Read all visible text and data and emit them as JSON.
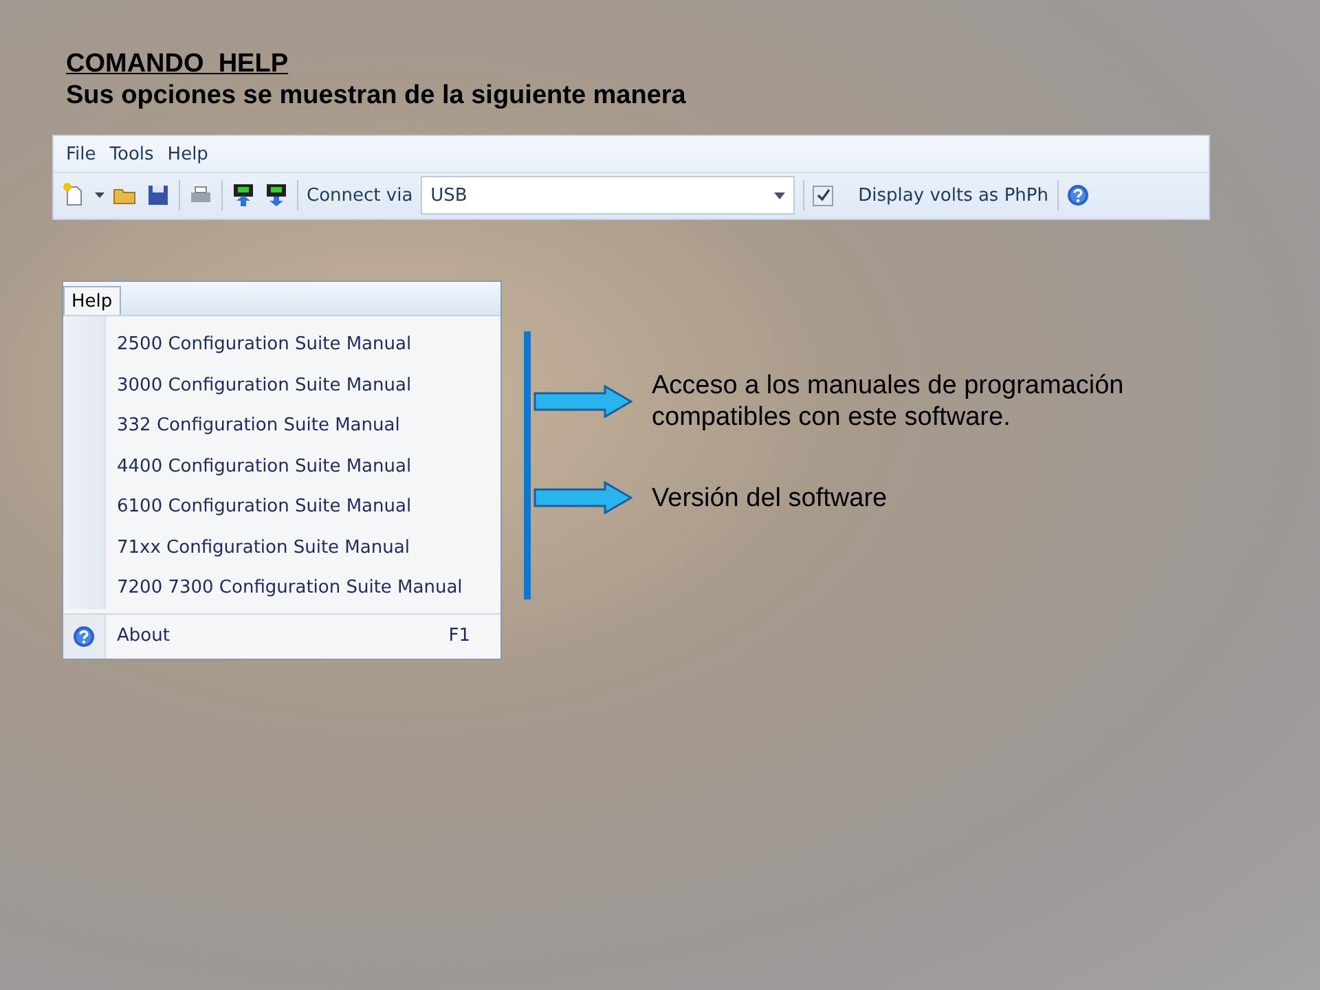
{
  "heading": {
    "title": "COMANDO  HELP",
    "subtitle": "Sus opciones se muestran de la siguiente manera"
  },
  "menu_bar": [
    "File",
    "Tools",
    "Help"
  ],
  "toolbar": {
    "connect_label": "Connect via",
    "connection": "USB",
    "checkbox": {
      "label": "Display volts as PhPh",
      "checked": true
    }
  },
  "help_menu": {
    "title": "Help",
    "items": [
      {
        "label": "2500 Configuration Suite Manual"
      },
      {
        "label": "3000 Configuration Suite Manual"
      },
      {
        "label": "332 Configuration Suite Manual"
      },
      {
        "label": "4400 Configuration Suite Manual"
      },
      {
        "label": "6100 Configuration Suite Manual"
      },
      {
        "label": "71xx Configuration Suite Manual"
      },
      {
        "label": "7200 7300 Configuration Suite Manual"
      }
    ],
    "about": {
      "label": "About",
      "shortcut": "F1"
    }
  },
  "callouts": [
    {
      "text": "Acceso a los manuales de programación compatibles con este software."
    },
    {
      "text": "Versión del software"
    }
  ]
}
